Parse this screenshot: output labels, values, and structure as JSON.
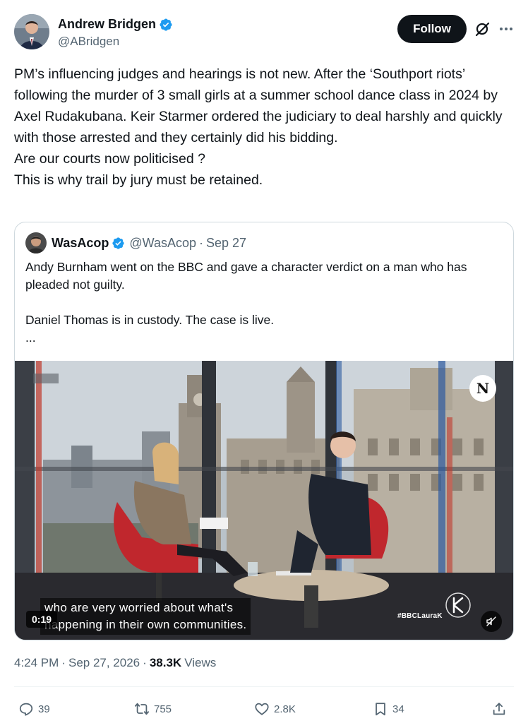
{
  "author": {
    "name": "Andrew Bridgen",
    "handle": "@ABridgen",
    "follow_label": "Follow"
  },
  "post": {
    "text": "PM’s influencing judges and hearings is not new. After the ‘Southport riots’ following the murder of 3 small girls at a summer school dance class in 2024 by Axel Rudakubana. Keir Starmer ordered the judiciary to deal harshly and quickly with those arrested and they certainly did his bidding.\nAre our courts now politicised ?\nThis is why trail by jury must be retained."
  },
  "quote": {
    "name": "WasAcop",
    "handle": "@WasAcop",
    "separator": "·",
    "date": "Sep 27",
    "text": "Andy Burnham went on the BBC and gave a character verdict on a man who has pleaded not guilty.\n\nDaniel Thomas is in custody. The case is live.\n...",
    "video": {
      "subtitle": "who are very worried about what's\nhappening in their own communities.",
      "time": "0:19",
      "badge": "N",
      "hashtag": "#BBCLauraK"
    }
  },
  "meta": {
    "time": "4:24 PM",
    "separator": "·",
    "date": "Sep 27, 2026",
    "separator2": "·",
    "views_count": "38.3K",
    "views_label": "Views"
  },
  "actions": {
    "replies": "39",
    "reposts": "755",
    "likes": "2.8K",
    "bookmarks": "34"
  },
  "colors": {
    "verified": "#1d9bf0",
    "secondary_text": "#536471",
    "primary_text": "#0f1419",
    "border": "#cfd9de"
  },
  "icons": [
    "verified-badge-icon",
    "grok-icon",
    "more-icon",
    "mute-icon",
    "reply-icon",
    "repost-icon",
    "like-icon",
    "bookmark-icon",
    "share-icon"
  ]
}
